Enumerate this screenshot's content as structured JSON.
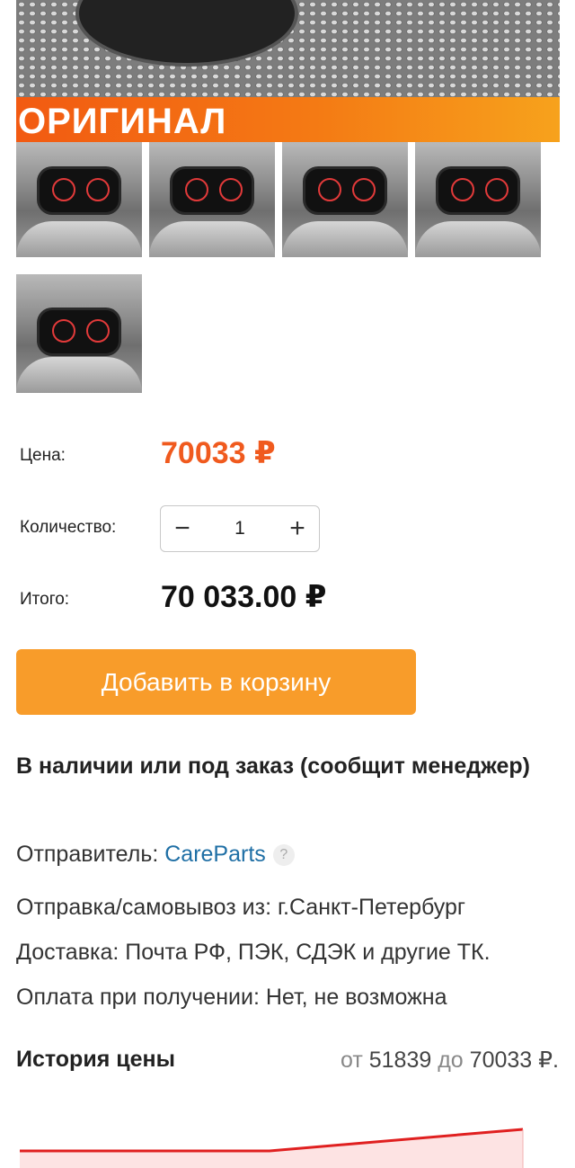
{
  "hero": {
    "banner_text": "ОРИГИНАЛ"
  },
  "price": {
    "label": "Цена:",
    "value": "70033 ₽"
  },
  "quantity": {
    "label": "Количество:",
    "value": "1",
    "minus": "−",
    "plus": "+"
  },
  "total": {
    "label": "Итого:",
    "value": "70 033.00 ₽"
  },
  "cart_button": "Добавить в корзину",
  "availability": "В наличии или под заказ (сообщит менеджер)",
  "sender": {
    "label": "Отправитель:",
    "name": "CareParts",
    "help": "?"
  },
  "shipping_from": "Отправка/самовывоз из: г.Санкт-Петербург",
  "delivery": "Доставка: Почта РФ, ПЭК, СДЭК и другие ТК.",
  "payment": "Оплата при получении: Нет, не возможна",
  "price_history": {
    "title": "История цены",
    "from_word": "от",
    "min": "51839",
    "to_word": "до",
    "max": "70033 ₽."
  },
  "colors": {
    "accent": "#f05a1e",
    "button": "#f89c2a",
    "link": "#1f6fa5",
    "chart_line": "#e02020"
  }
}
